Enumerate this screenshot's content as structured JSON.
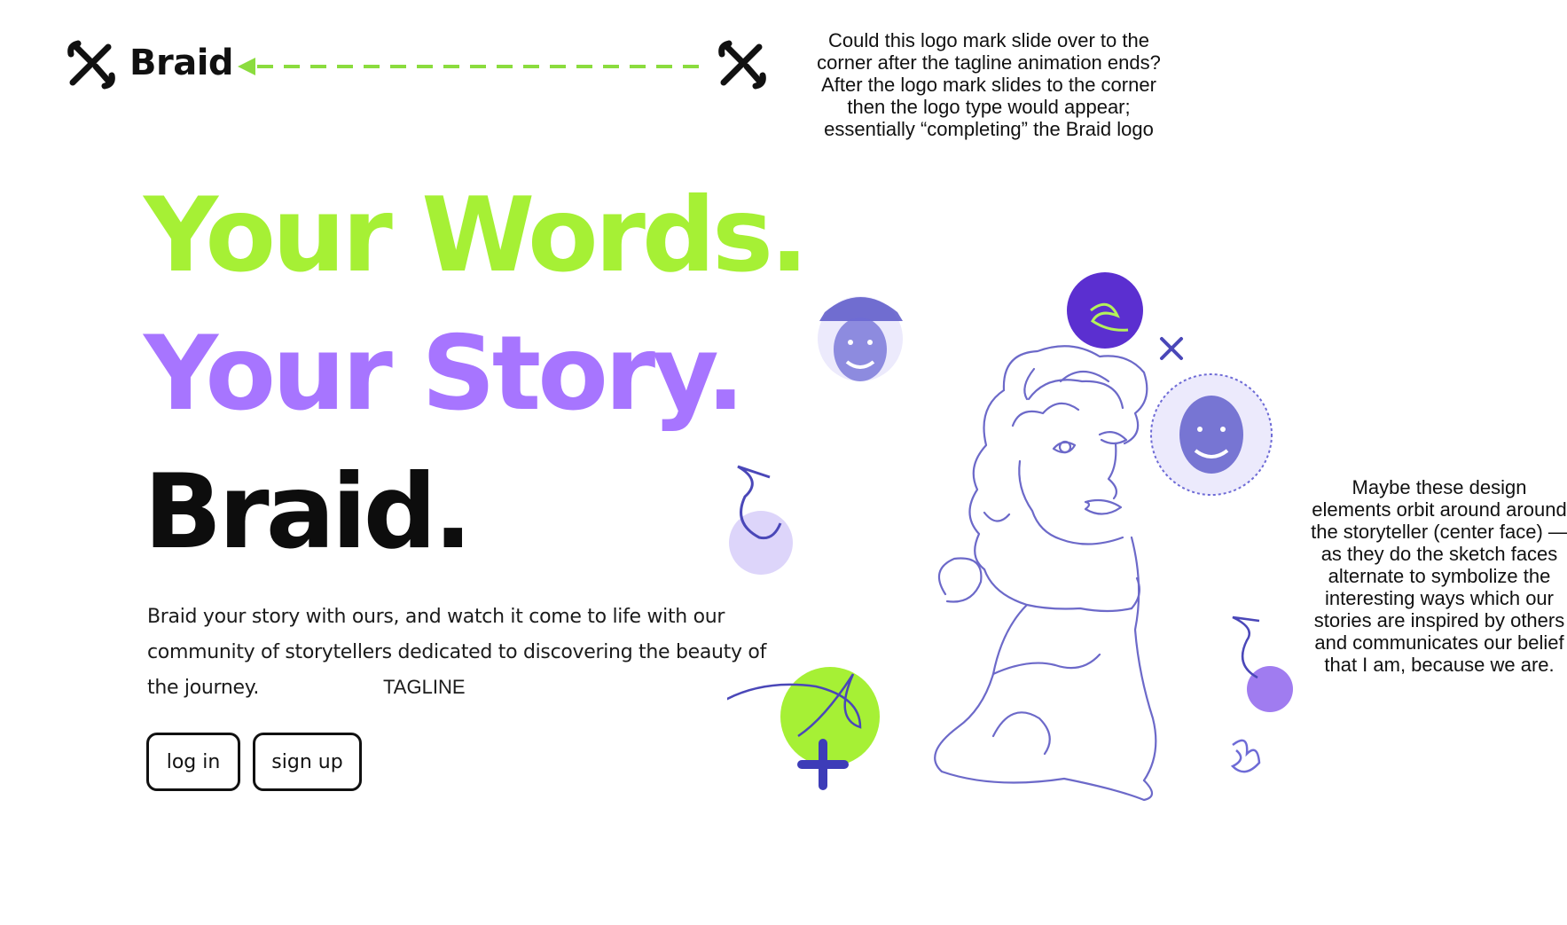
{
  "header": {
    "brand_name": "Braid",
    "logo_icon": "braid-x-mark-icon",
    "arrow_icon": "dashed-arrow-left-icon"
  },
  "notes": {
    "top": "Could this logo mark slide over to the corner after the tagline animation ends? After the logo mark slides to the corner then the logo type would appear; essentially “completing” the Braid logo",
    "right": "Maybe these design elements orbit around around the storyteller (center face) — as they do the sketch faces alternate to symbolize the interesting ways which our stories are inspired by others and communicates our belief that I am, because we are."
  },
  "hero": {
    "line1": "Your Words.",
    "line2": "Your Story.",
    "line3": "Braid.",
    "description": "Braid your story with ours, and watch it come to life with our community of storytellers dedicated to discovering the beauty of the journey.",
    "tagline_label": "TAGLINE"
  },
  "actions": {
    "login_label": "log in",
    "signup_label": "sign up"
  },
  "colors": {
    "lime": "#a6f035",
    "purple": "#a775ff",
    "deep_purple": "#5b2fd0",
    "sketch_blue": "#4a47b8",
    "lavender": "#ddd5fa"
  }
}
